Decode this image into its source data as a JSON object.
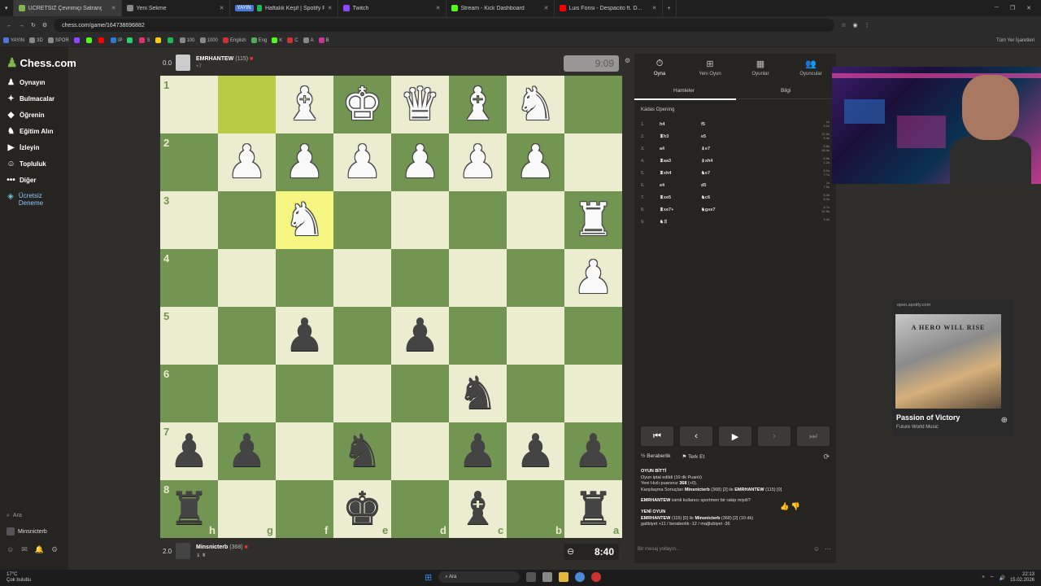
{
  "browser": {
    "tabs": [
      {
        "label": "ÜCRETSİZ Çevrimiçi Satranç Oy...",
        "color": "#81b64c",
        "active": true
      },
      {
        "label": "Yeni Sekme",
        "color": "#888888",
        "active": false
      },
      {
        "label": "Haftalık Keşif | Spotify Playl...",
        "color": "#1db954",
        "active": false,
        "badge": "YAYIN"
      },
      {
        "label": "Twitch",
        "color": "#9146ff",
        "active": false
      },
      {
        "label": "Stream - Kick Dashboard",
        "color": "#53fc18",
        "active": false
      },
      {
        "label": "Luis Fonsi - Despacito ft. D...",
        "color": "#ff0000",
        "active": false
      }
    ],
    "url": "chess.com/game/164738696882",
    "bookmarks": [
      {
        "label": "YAYIN",
        "color": "#4a7ad6"
      },
      {
        "label": "3D",
        "color": "#888888"
      },
      {
        "label": "SPOR",
        "color": "#888888"
      },
      {
        "label": "",
        "color": "#9146ff"
      },
      {
        "label": "",
        "color": "#53fc18"
      },
      {
        "label": "",
        "color": "#ff0000"
      },
      {
        "label": "IP",
        "color": "#2a7ad6"
      },
      {
        "label": "",
        "color": "#25d366"
      },
      {
        "label": "S",
        "color": "#e1306c"
      },
      {
        "label": "",
        "color": "#ffcc00"
      },
      {
        "label": "",
        "color": "#1db954"
      },
      {
        "label": "100",
        "color": "#888888"
      },
      {
        "label": "1000",
        "color": "#888888"
      },
      {
        "label": "English",
        "color": "#cc3333"
      },
      {
        "label": "Eng",
        "color": "#55aa55"
      },
      {
        "label": "K",
        "color": "#53fc18"
      },
      {
        "label": "C",
        "color": "#cc3333"
      },
      {
        "label": "A",
        "color": "#888888"
      },
      {
        "label": "B",
        "color": "#cc3399"
      }
    ],
    "all_bookmarks": "Tüm Yer İşaretleri"
  },
  "sidebar": {
    "logo": "Chess.com",
    "items": [
      {
        "label": "Oynayın",
        "icon": "♟"
      },
      {
        "label": "Bulmacalar",
        "icon": "✦"
      },
      {
        "label": "Öğrenin",
        "icon": "◆"
      },
      {
        "label": "Eğitim Alın",
        "icon": "♞"
      },
      {
        "label": "İzleyin",
        "icon": "▶"
      },
      {
        "label": "Topluluk",
        "icon": "☺"
      },
      {
        "label": "Diğer",
        "icon": "•••"
      },
      {
        "label": "Ücretsiz Deneme",
        "icon": "◈"
      }
    ],
    "search": "Ara",
    "user": "Minsnicterb"
  },
  "top_player": {
    "score": "0.0",
    "name": "EMRHANTEW",
    "rating": "(115)",
    "sub": "+7",
    "clock": "9:09"
  },
  "bottom_player": {
    "score": "2.0",
    "name": "Minsnicterb",
    "rating": "(368)",
    "sub": "♝ ♜",
    "clock": "8:40"
  },
  "board": {
    "ranks": [
      "1",
      "2",
      "3",
      "4",
      "5",
      "6",
      "7",
      "8"
    ],
    "files": [
      "h",
      "g",
      "f",
      "e",
      "d",
      "c",
      "b",
      "a"
    ],
    "highlights": [
      "g1",
      "f3"
    ],
    "pieces": [
      {
        "sq": "f1",
        "g": "♝",
        "c": "w"
      },
      {
        "sq": "e1",
        "g": "♚",
        "c": "w"
      },
      {
        "sq": "d1",
        "g": "♛",
        "c": "w"
      },
      {
        "sq": "c1",
        "g": "♝",
        "c": "w"
      },
      {
        "sq": "b1",
        "g": "♞",
        "c": "w"
      },
      {
        "sq": "g2",
        "g": "♟",
        "c": "w"
      },
      {
        "sq": "f2",
        "g": "♟",
        "c": "w"
      },
      {
        "sq": "e2",
        "g": "♟",
        "c": "w"
      },
      {
        "sq": "d2",
        "g": "♟",
        "c": "w"
      },
      {
        "sq": "c2",
        "g": "♟",
        "c": "w"
      },
      {
        "sq": "b2",
        "g": "♟",
        "c": "w"
      },
      {
        "sq": "f3",
        "g": "♞",
        "c": "w"
      },
      {
        "sq": "a3",
        "g": "♜",
        "c": "w"
      },
      {
        "sq": "a4",
        "g": "♟",
        "c": "w"
      },
      {
        "sq": "f5",
        "g": "♟",
        "c": "b"
      },
      {
        "sq": "d5",
        "g": "♟",
        "c": "b"
      },
      {
        "sq": "c6",
        "g": "♞",
        "c": "b"
      },
      {
        "sq": "h7",
        "g": "♟",
        "c": "b"
      },
      {
        "sq": "g7",
        "g": "♟",
        "c": "b"
      },
      {
        "sq": "e7",
        "g": "♞",
        "c": "b"
      },
      {
        "sq": "c7",
        "g": "♟",
        "c": "b"
      },
      {
        "sq": "b7",
        "g": "♟",
        "c": "b"
      },
      {
        "sq": "a7",
        "g": "♟",
        "c": "b"
      },
      {
        "sq": "h8",
        "g": "♜",
        "c": "b"
      },
      {
        "sq": "e8",
        "g": "♚",
        "c": "b"
      },
      {
        "sq": "c8",
        "g": "♝",
        "c": "b"
      },
      {
        "sq": "a8",
        "g": "♜",
        "c": "b"
      }
    ]
  },
  "panel": {
    "tabs": [
      {
        "label": "Oyna",
        "icon": "⏱"
      },
      {
        "label": "Yeni Oyun",
        "icon": "⊞"
      },
      {
        "label": "Oyunlar",
        "icon": "▦"
      },
      {
        "label": "Oyuncular",
        "icon": "👥"
      }
    ],
    "subtabs": [
      "Hamleler",
      "Bilgi"
    ],
    "opening": "Kádas Opening",
    "moves": [
      {
        "n": "1.",
        "w": "h4",
        "b": "f5",
        "t": "1s\n0.1s"
      },
      {
        "n": "2.",
        "w": "♜h3",
        "b": "e5",
        "t": "12.0s\n5.4s"
      },
      {
        "n": "3.",
        "w": "a4",
        "b": "♝e7",
        "t": "5.6s\n18.4s"
      },
      {
        "n": "4.",
        "w": "♜aa3",
        "b": "♝xh4",
        "t": "6.9s\n1.2s"
      },
      {
        "n": "5.",
        "w": "♜xh4",
        "b": "♞e7",
        "t": "6.9s\n7.7s"
      },
      {
        "n": "6.",
        "w": "e4",
        "b": "d5",
        "t": "1s\n7.5s"
      },
      {
        "n": "7.",
        "w": "♜xe5",
        "b": "♞c6",
        "t": "6.3s\n6.2s"
      },
      {
        "n": "8.",
        "w": "♜xe7+",
        "b": "♞gxe7",
        "t": "6.7s\n10.9s"
      },
      {
        "n": "9.",
        "w": "♞♖",
        "b": "",
        "t": "5.2s"
      }
    ],
    "nav": [
      "⏮",
      "‹",
      "▶",
      "›",
      "⏭"
    ],
    "draw": "Beraberlik",
    "resign": "Terk Et",
    "chat": {
      "l1": "OYUN BİTTİ",
      "l2": "Oyun iptal edildi (10 dk Puanlı)",
      "l3a": "Yeni Hızlı puanınız ",
      "l3b": "368",
      "l3c": " (+0).",
      "l4a": "Karşılaşma Sonuçları ",
      "l4b": "Minsnicterb",
      "l4c": " (368) [2] ile ",
      "l4d": "EMRHANTEW",
      "l4e": " (115) [0]",
      "l5a": "EMRHANTEW",
      "l5b": " isimli kullanıcı sportmen bir rakip miydi?",
      "l6": "YENİ OYUN",
      "l7a": "EMRHANTEW",
      "l7b": " (115) [0] ile ",
      "l7c": "Minsnicterb",
      "l7d": " (368) [2] (10 dk)",
      "l8": "galibiyet +11 / beraberlik -12 / mağlubiyet -36"
    },
    "chat_placeholder": "Bir mesaj yollayın..."
  },
  "spotify": {
    "url": "open.spotify.com",
    "cover_text": "A HERO WILL RISE",
    "title": "Passion of Victory",
    "artist": "Future World Music"
  },
  "taskbar": {
    "temp": "17°C",
    "weather": "Çok bulutlu",
    "search": "Ara",
    "time": "22:13",
    "date": "15.02.2026"
  }
}
